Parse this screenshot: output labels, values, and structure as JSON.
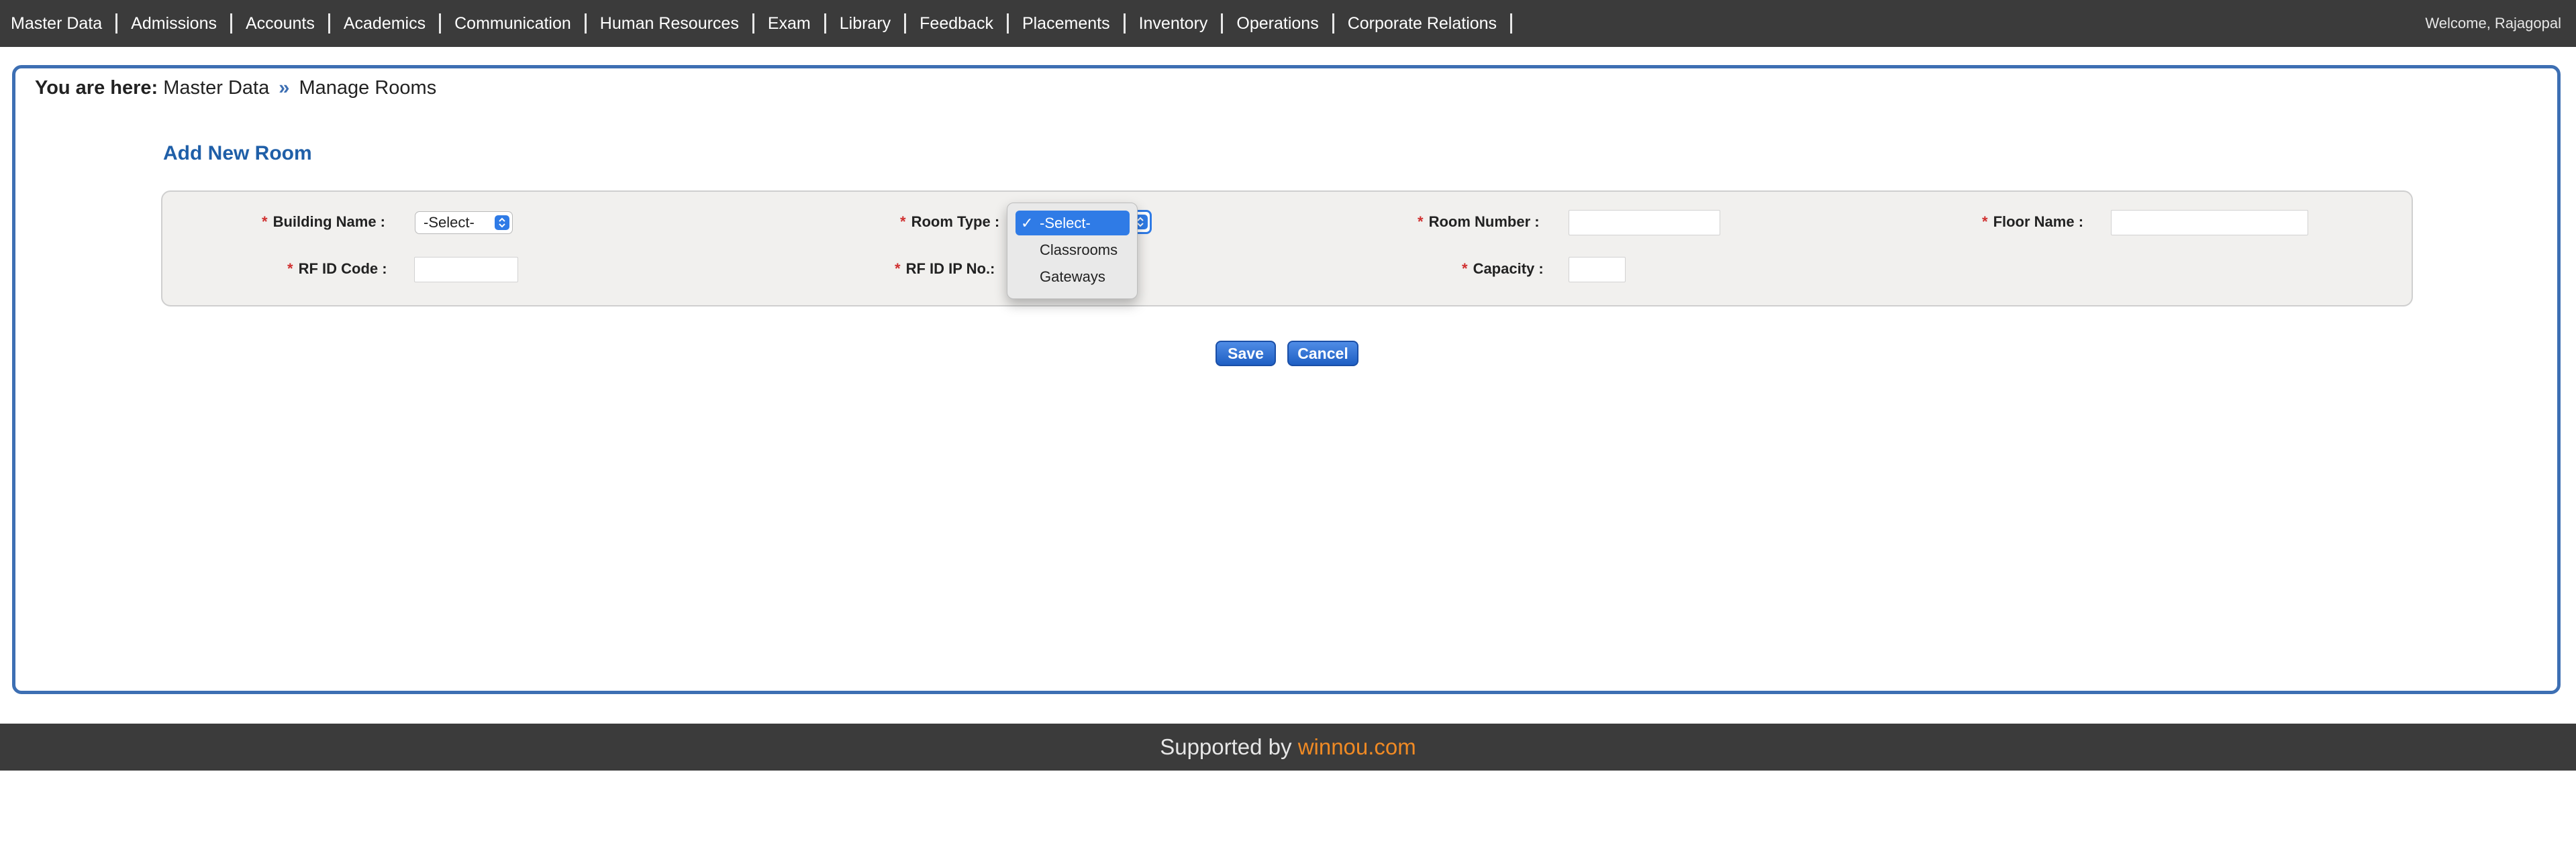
{
  "nav": {
    "items": [
      {
        "label": "Master Data"
      },
      {
        "label": "Admissions"
      },
      {
        "label": "Accounts"
      },
      {
        "label": "Academics"
      },
      {
        "label": "Communication"
      },
      {
        "label": "Human Resources"
      },
      {
        "label": "Exam"
      },
      {
        "label": "Library"
      },
      {
        "label": "Feedback"
      },
      {
        "label": "Placements"
      },
      {
        "label": "Inventory"
      },
      {
        "label": "Operations"
      },
      {
        "label": "Corporate Relations"
      }
    ],
    "welcome": "Welcome, Rajagopal"
  },
  "breadcrumb": {
    "prefix": "You are here:",
    "root": "Master Data",
    "separator": "»",
    "current": "Manage Rooms"
  },
  "form": {
    "title": "Add New Room",
    "required_mark": "*",
    "building_name": {
      "label": "Building Name :",
      "value": "-Select-"
    },
    "room_type": {
      "label": "Room Type :"
    },
    "room_number": {
      "label": "Room Number :",
      "value": ""
    },
    "floor_name": {
      "label": "Floor Name :",
      "value": ""
    },
    "rfid_code": {
      "label": "RF ID Code :",
      "value": ""
    },
    "rfid_ip": {
      "label": "RF ID IP No.:",
      "value": ""
    },
    "capacity": {
      "label": "Capacity :",
      "value": ""
    }
  },
  "room_type_dropdown": {
    "check": "✓",
    "options": [
      {
        "label": "-Select-",
        "selected": true
      },
      {
        "label": "Classrooms",
        "selected": false
      },
      {
        "label": "Gateways",
        "selected": false
      }
    ]
  },
  "buttons": {
    "save": "Save",
    "cancel": "Cancel"
  },
  "footer": {
    "prefix": "Supported by",
    "brand": "winnou.com"
  },
  "colors": {
    "nav_bg": "#3b3b3b",
    "panel_border": "#3d6fb3",
    "title_blue": "#1f5fa8",
    "accent_blue": "#2f7be6",
    "required_red": "#d03030",
    "brand_orange": "#f08a24"
  },
  "icons": {
    "select_arrow": "chevron-updown-icon",
    "check": "check-icon"
  }
}
